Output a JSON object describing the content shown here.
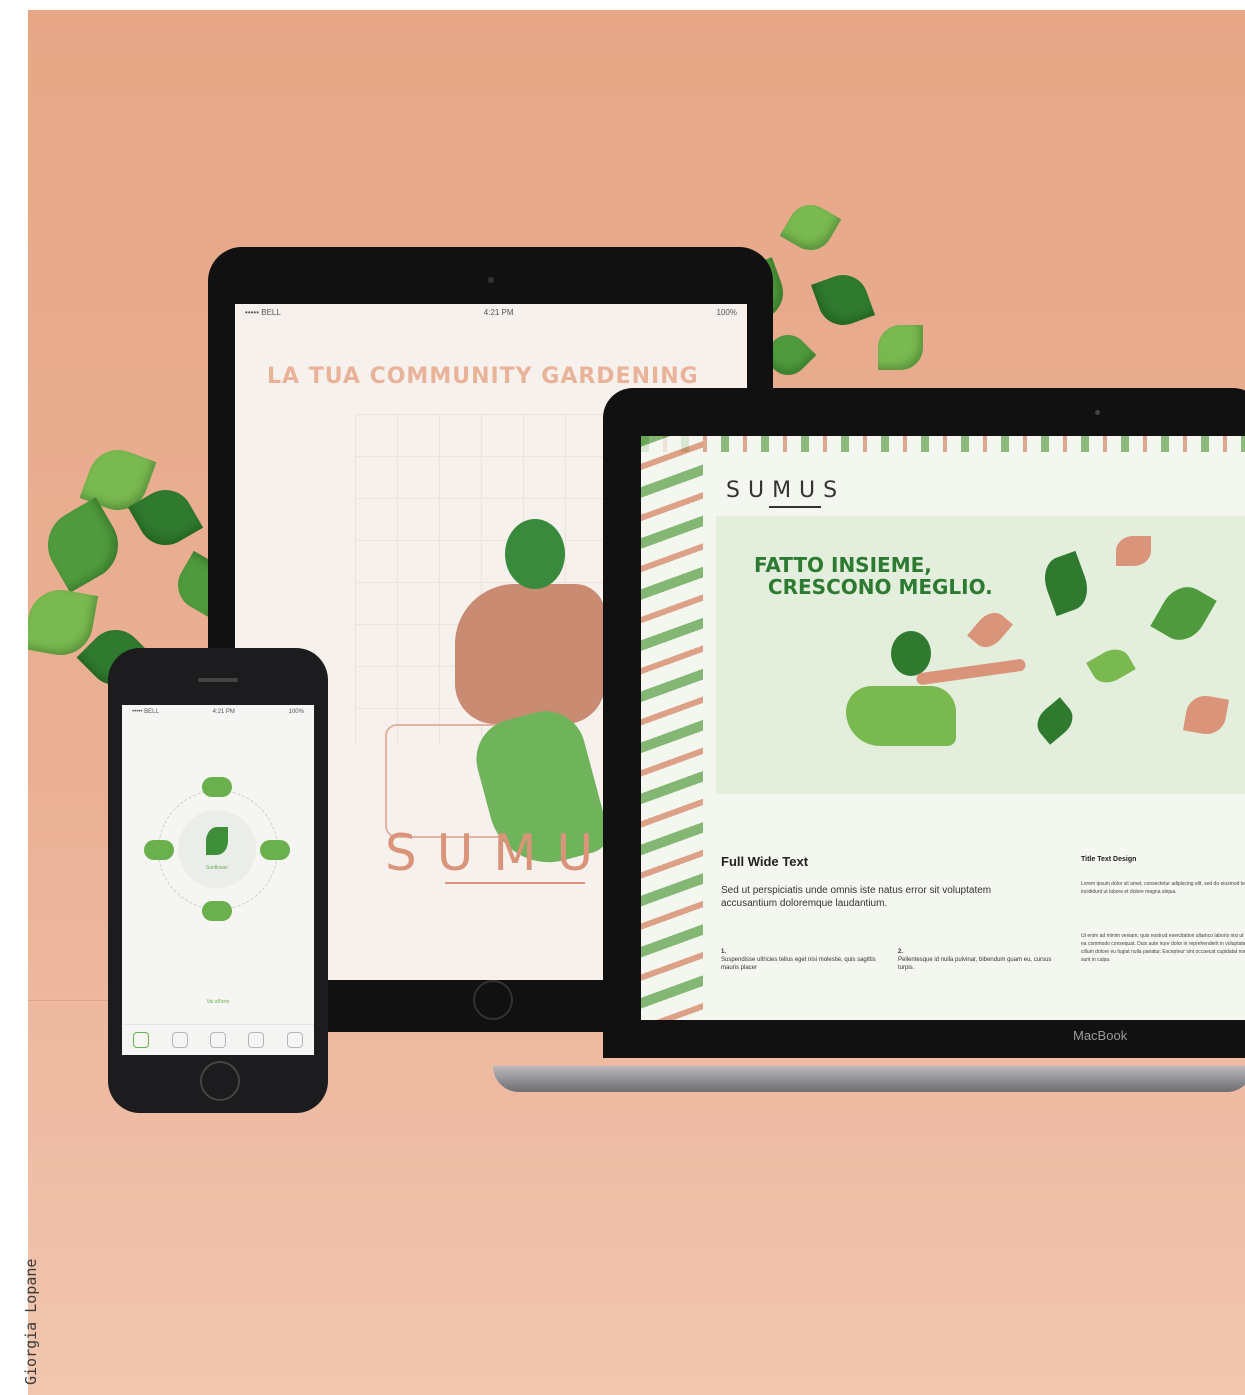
{
  "tablet": {
    "status_left": "••••• BELL",
    "status_time": "4:21 PM",
    "status_right": "100%",
    "headline": "LA TUA COMMUNITY GARDENING",
    "brand": "SUMUS"
  },
  "laptop": {
    "logo": "SUMUS",
    "hero_title": "FATTO INSIEME,\n  CRESCONO MEGLIO.",
    "section_title": "Full Wide Text",
    "lead": "Sed ut perspiciatis unde omnis iste natus error sit voluptatem accusantium doloremque laudantium.",
    "col1_number": "1.",
    "col1_text": "Suspendisse ultricies tellus eget nisi molestie, quis sagittis mauris placer",
    "col2_number": "2.",
    "col2_text": "Pellentesque id nulla pulvinar, bibendum quam eu, cursus turpis.",
    "side_title": "Title Text Design",
    "side_text_1": "Lorem ipsum dolor sit amet, consectetur adipiscing elit, sed do eiusmod tempor incididunt ut labore et dolore magna aliqua.",
    "side_text_2": "Ut enim ad minim veniam, quis nostrud exercitation ullamco laboris nisi ut aliquip ex ea commodo consequat. Duis aute irure dolor in reprehenderit in voluptate velit esse cillum dolore eu fugiat nulla pariatur. Excepteur sint occaecat cupidatat non proident, sunt in culpa.",
    "model_label": "MacBook"
  },
  "phone": {
    "status_left": "••••• BELL",
    "status_time": "4:21 PM",
    "status_right": "100%",
    "center_label": "Sunflower",
    "link": "Vai all'orto"
  },
  "credit": "Giorgia Lopane",
  "colors": {
    "background": "#e9ad90",
    "accent_green": "#6ab04c",
    "accent_peach": "#d9947a"
  }
}
